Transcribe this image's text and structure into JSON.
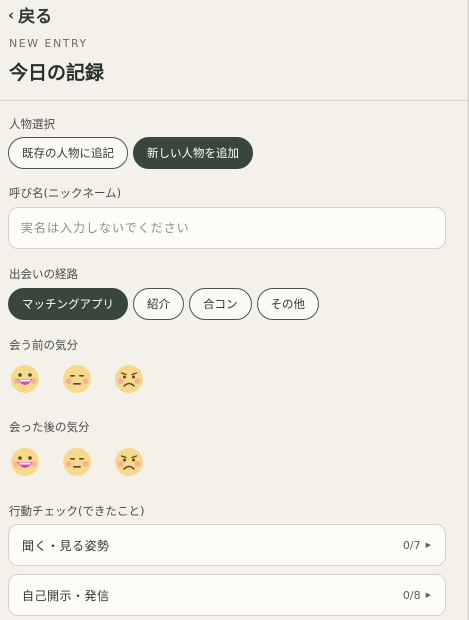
{
  "header": {
    "back_label": "戻る",
    "eyebrow": "NEW ENTRY",
    "title": "今日の記録"
  },
  "person": {
    "label": "人物選択",
    "options": [
      "既存の人物に追記",
      "新しい人物を追加"
    ],
    "selected": "新しい人物を追加"
  },
  "nickname": {
    "label": "呼び名(ニックネーム)",
    "value": "",
    "placeholder": "実名は入力しないでください"
  },
  "route": {
    "label": "出会いの経路",
    "options": [
      "マッチングアプリ",
      "紹介",
      "合コン",
      "その他"
    ],
    "selected": "マッチングアプリ"
  },
  "mood_before": {
    "label": "会う前の気分",
    "faces": [
      "grinning-face-icon",
      "neutral-face-icon",
      "frowning-face-icon"
    ]
  },
  "mood_after": {
    "label": "会った後の気分",
    "faces": [
      "grinning-face-icon",
      "neutral-face-icon",
      "frowning-face-icon"
    ]
  },
  "action_check": {
    "label": "行動チェック(できたこと)",
    "items": [
      {
        "label": "聞く・見る姿勢",
        "count": "0/7"
      },
      {
        "label": "自己開示・発信",
        "count": "0/8"
      }
    ]
  },
  "colors": {
    "background": "#f4f1ea",
    "accent": "#39463b",
    "face_yellow": "#f7d98c",
    "face_cheek": "#f2a89a",
    "face_mouth_open": "#d44aa8"
  }
}
